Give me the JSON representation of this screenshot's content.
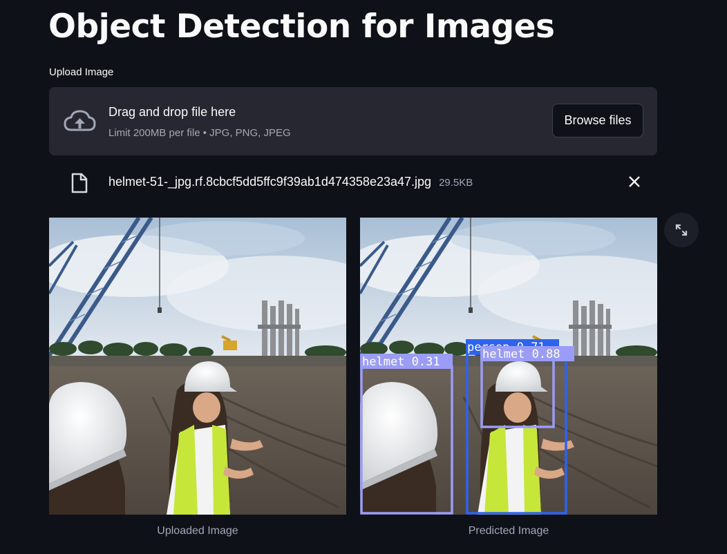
{
  "title": "Object Detection for Images",
  "uploader": {
    "label": "Upload Image",
    "drop_title": "Drag and drop file here",
    "drop_subtitle": "Limit 200MB per file • JPG, PNG, JPEG",
    "browse_label": "Browse files",
    "icon": "cloud-upload-icon"
  },
  "file": {
    "name": "helmet-51-_jpg.rf.8cbcf5dd5ffc9f39ab1d474358e23a47.jpg",
    "size": "29.5KB",
    "icon": "file-icon",
    "remove_icon": "close-icon"
  },
  "images": {
    "uploaded_caption": "Uploaded Image",
    "predicted_caption": "Predicted Image"
  },
  "detections": [
    {
      "label": "helmet",
      "confidence": "0.31",
      "color": "#9b9cf7"
    },
    {
      "label": "person",
      "confidence": "0.71",
      "color": "#2e63f0"
    },
    {
      "label": "helmet",
      "confidence": "0.88",
      "color": "#9b9cf7"
    }
  ],
  "colors": {
    "background": "#0e1117",
    "panel": "#262730",
    "muted_text": "#a3a8b8"
  }
}
